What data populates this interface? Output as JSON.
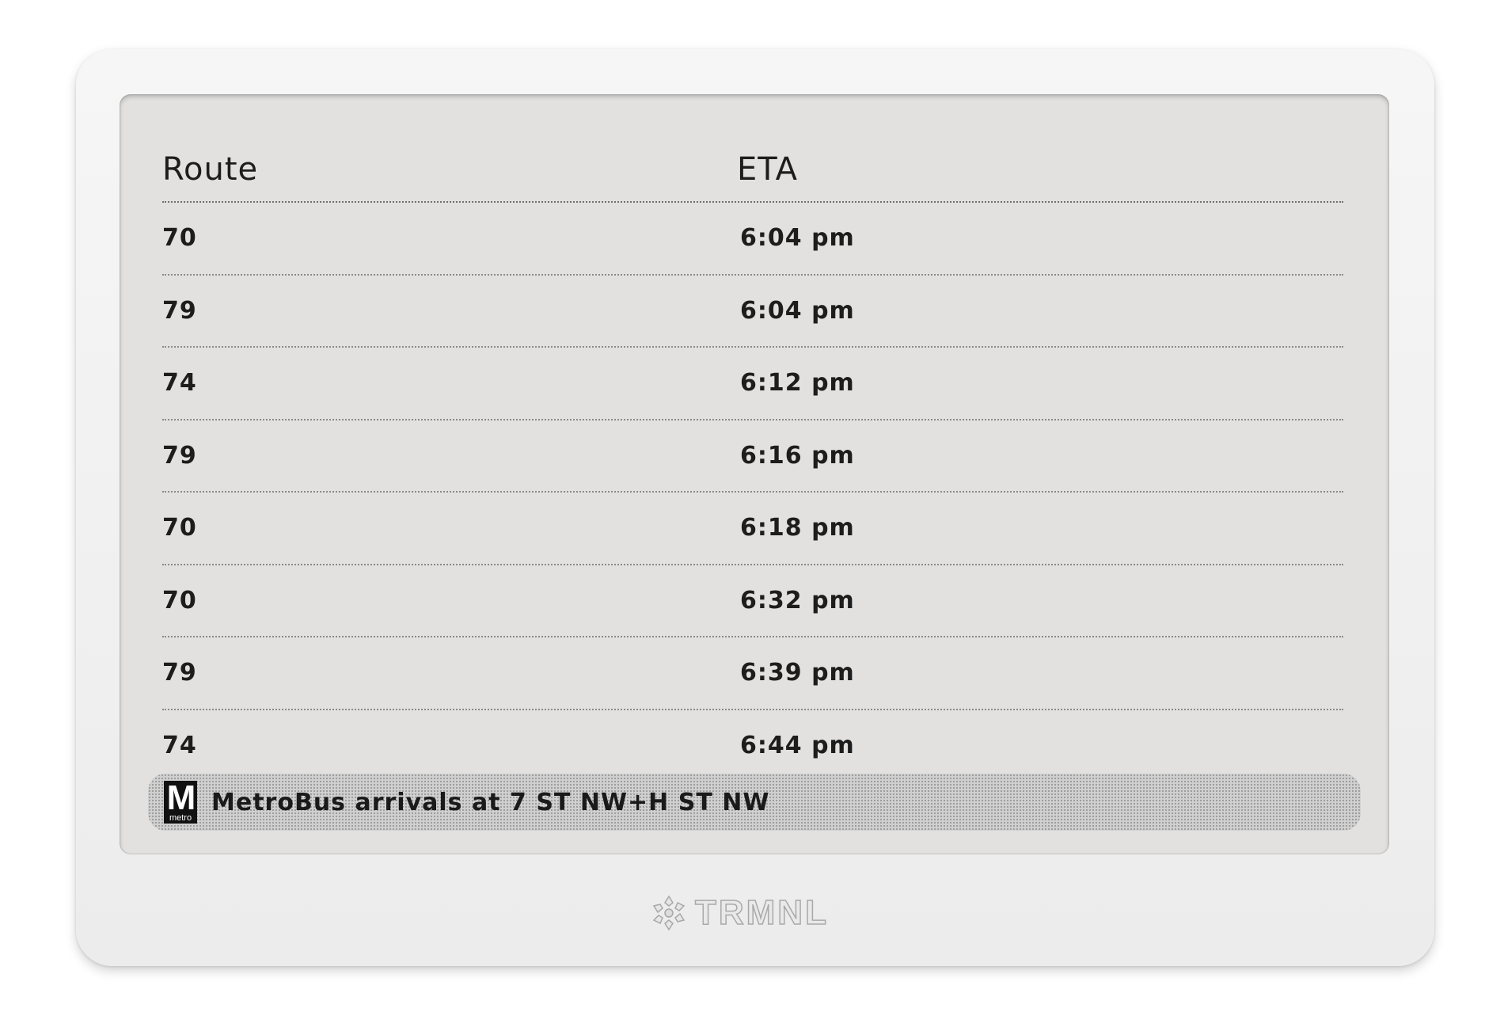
{
  "table": {
    "headers": {
      "route": "Route",
      "eta": "ETA"
    },
    "rows": [
      {
        "route": "70",
        "eta": "6:04 pm"
      },
      {
        "route": "79",
        "eta": "6:04 pm"
      },
      {
        "route": "74",
        "eta": "6:12 pm"
      },
      {
        "route": "79",
        "eta": "6:16 pm"
      },
      {
        "route": "70",
        "eta": "6:18 pm"
      },
      {
        "route": "70",
        "eta": "6:32 pm"
      },
      {
        "route": "79",
        "eta": "6:39 pm"
      },
      {
        "route": "74",
        "eta": "6:44 pm"
      }
    ]
  },
  "title_bar": {
    "logo_letter": "M",
    "logo_subtext": "metro",
    "text": "MetroBus arrivals at 7 ST NW+H ST NW"
  },
  "device": {
    "brand_text": "TRMNL",
    "brand_icon": "trmnl-logo-icon"
  }
}
